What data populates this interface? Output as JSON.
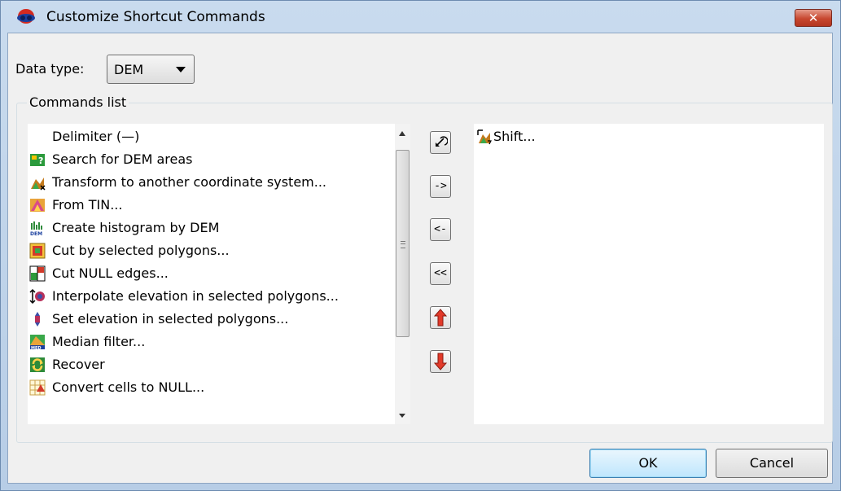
{
  "window": {
    "title": "Customize Shortcut Commands",
    "close_label": "✕"
  },
  "data_type": {
    "label": "Data type:",
    "selected": "DEM"
  },
  "commands_group": {
    "legend": "Commands list"
  },
  "available_commands": [
    {
      "label": "Delimiter (—)",
      "icon": "none"
    },
    {
      "label": "Search for DEM areas",
      "icon": "search-dem-areas-icon"
    },
    {
      "label": "Transform to another coordinate system...",
      "icon": "transform-coordinates-icon"
    },
    {
      "label": "From TIN...",
      "icon": "from-tin-icon"
    },
    {
      "label": "Create histogram by DEM",
      "icon": "histogram-dem-icon"
    },
    {
      "label": "Cut by selected polygons...",
      "icon": "cut-polygons-icon"
    },
    {
      "label": "Cut NULL edges...",
      "icon": "cut-null-edges-icon"
    },
    {
      "label": "Interpolate elevation in selected polygons...",
      "icon": "interpolate-elevation-icon"
    },
    {
      "label": "Set elevation in selected polygons...",
      "icon": "set-elevation-icon"
    },
    {
      "label": "Median filter...",
      "icon": "median-filter-icon"
    },
    {
      "label": "Recover",
      "icon": "recover-icon"
    },
    {
      "label": "Convert cells to NULL...",
      "icon": "convert-null-icon"
    }
  ],
  "transfer_buttons": {
    "reset": "↶",
    "add": "->",
    "remove": "<-",
    "remove_all": "<<",
    "move_up": "↑",
    "move_down": "↓"
  },
  "selected_commands": [
    {
      "label": "Shift...",
      "icon": "shift-icon"
    }
  ],
  "footer": {
    "ok_label": "OK",
    "cancel_label": "Cancel"
  }
}
